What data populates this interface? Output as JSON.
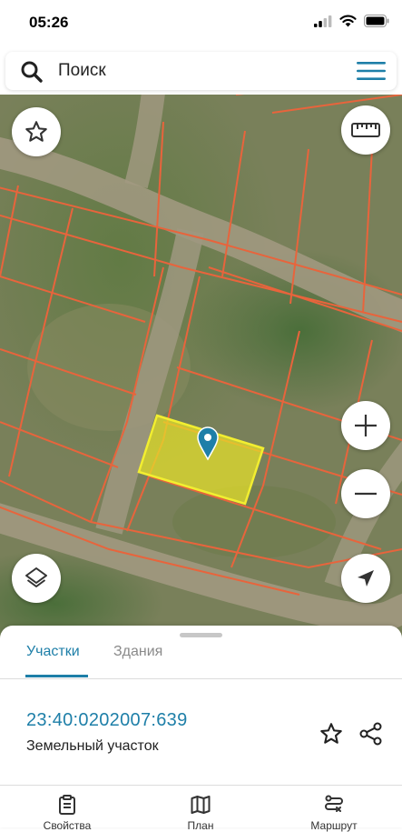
{
  "status_bar": {
    "time": "05:26"
  },
  "search": {
    "placeholder": "Поиск",
    "value": ""
  },
  "map": {
    "buttons": [
      "favorite-star-icon",
      "ruler-icon",
      "zoom-in-icon",
      "zoom-out-icon",
      "layers-icon",
      "locate-arrow-icon"
    ],
    "colors": {
      "parcel_lines": "#e8643c",
      "selected_fill": "#e6e02a",
      "marker": "#1e7fa8"
    }
  },
  "sheet": {
    "tabs": [
      {
        "label": "Участки",
        "active": true
      },
      {
        "label": "Здания",
        "active": false
      }
    ],
    "parcel": {
      "id": "23:40:0202007:639",
      "type": "Земельный участок"
    }
  },
  "bottom_nav": {
    "items": [
      {
        "icon": "clipboard-icon",
        "label": "Свойства"
      },
      {
        "icon": "map-icon",
        "label": "План"
      },
      {
        "icon": "route-icon",
        "label": "Маршрут"
      }
    ]
  },
  "colors": {
    "accent": "#1e7fa8",
    "tab_inactive": "#8a8a8a"
  }
}
